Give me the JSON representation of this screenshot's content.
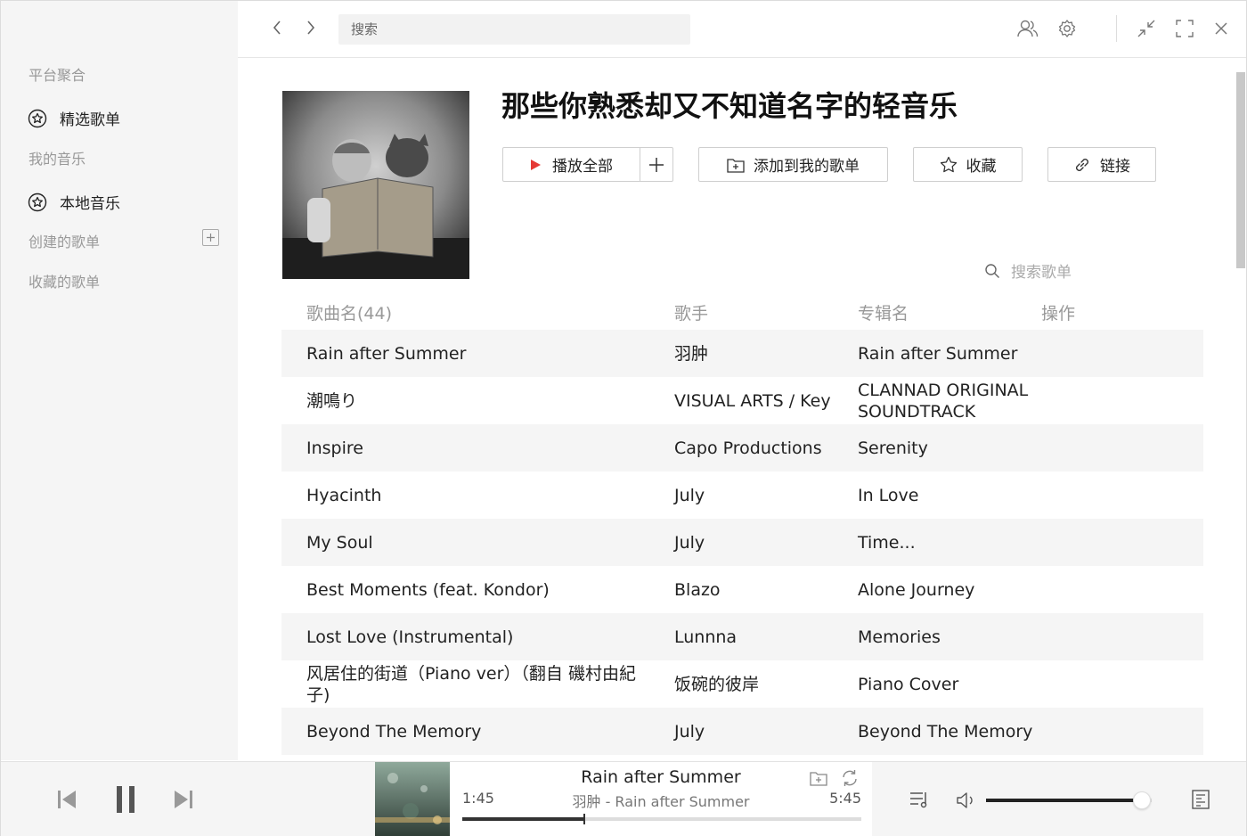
{
  "sidebar": {
    "section_platform": "平台聚合",
    "item_featured": "精选歌单",
    "section_my_music": "我的音乐",
    "item_local": "本地音乐",
    "section_created": "创建的歌单",
    "section_collected": "收藏的歌单"
  },
  "topbar": {
    "search_placeholder": "搜索"
  },
  "playlist": {
    "title": "那些你熟悉却又不知道名字的轻音乐",
    "play_all": "播放全部",
    "add_to_mine": "添加到我的歌单",
    "collect": "收藏",
    "link": "链接",
    "search_placeholder": "搜索歌单"
  },
  "table": {
    "headers": {
      "name": "歌曲名(44)",
      "artist": "歌手",
      "album": "专辑名",
      "action": "操作"
    },
    "rows": [
      {
        "name": "Rain after Summer",
        "artist": "羽肿",
        "album": "Rain after Summer"
      },
      {
        "name": "潮鳴り",
        "artist": "VISUAL ARTS / Key",
        "album": "CLANNAD ORIGINAL SOUNDTRACK"
      },
      {
        "name": "Inspire",
        "artist": "Capo Productions",
        "album": "Serenity"
      },
      {
        "name": "Hyacinth",
        "artist": "July",
        "album": "In Love"
      },
      {
        "name": "My Soul",
        "artist": "July",
        "album": "Time..."
      },
      {
        "name": "Best Moments (feat. Kondor)",
        "artist": "Blazo",
        "album": "Alone Journey"
      },
      {
        "name": "Lost Love (Instrumental)",
        "artist": "Lunnna",
        "album": "Memories"
      },
      {
        "name": "风居住的街道（Piano ver）（翻自 磯村由紀子)",
        "artist": "饭碗的彼岸",
        "album": "Piano Cover"
      },
      {
        "name": "Beyond The Memory",
        "artist": "July",
        "album": "Beyond The Memory"
      }
    ]
  },
  "player": {
    "title": "Rain after Summer",
    "subtitle": "羽肿 - Rain after Summer",
    "current_time": "1:45",
    "total_time": "5:45",
    "progress": 0.306,
    "volume": 0.94
  },
  "colors": {
    "accent_play": "#e53935",
    "sidebar_bg": "#f5f5f5",
    "row_stripe": "#f5f5f5"
  }
}
